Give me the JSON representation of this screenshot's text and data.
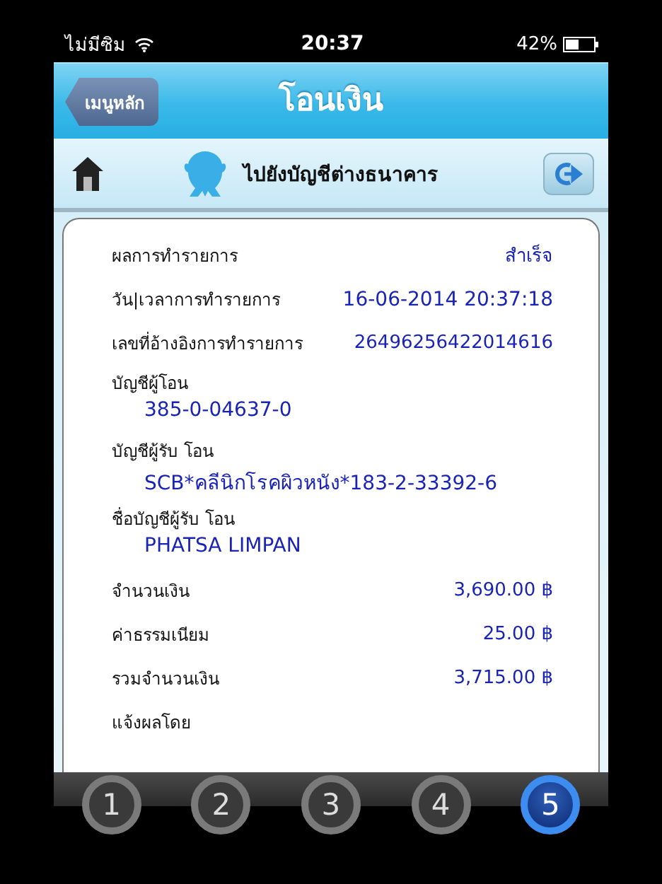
{
  "status_bar": {
    "carrier": "ไม่มีซิม",
    "time": "20:37",
    "battery": "42%"
  },
  "header": {
    "back_button": "เมนูหลัก",
    "title": "โอนเงิน"
  },
  "sub_header": {
    "title": "ไปยังบัญชีต่างธนาคาร"
  },
  "receipt": {
    "rows": [
      {
        "kind": "inline",
        "label": "ผลการทำรายการ",
        "value": "สำเร็จ"
      },
      {
        "kind": "inline",
        "label": "วัน|เวลาการทำรายการ",
        "value": "16-06-2014 20:37:18"
      },
      {
        "kind": "inline",
        "label": "เลขที่อ้างอิงการทำรายการ",
        "value": "26496256422014616"
      },
      {
        "kind": "stacked",
        "label": "บัญชีผู้โอน",
        "value": "385-0-04637-0"
      },
      {
        "kind": "stacked",
        "label": "บัญชีผู้รับ โอน",
        "value": "SCB*คลีนิกโรคผิวหนัง*183-2-33392-6"
      },
      {
        "kind": "stacked",
        "label": "ชื่อบัญชีผู้รับ โอน",
        "value": "PHATSA LIMPAN"
      },
      {
        "kind": "inline",
        "label": "จำนวนเงิน",
        "value": "3,690.00 ฿"
      },
      {
        "kind": "inline",
        "label": "ค่าธรรมเนียม",
        "value": "25.00 ฿"
      },
      {
        "kind": "inline",
        "label": "รวมจำนวนเงิน",
        "value": "3,715.00 ฿"
      },
      {
        "kind": "label",
        "label": "แจ้งผลโดย"
      }
    ]
  },
  "steps": [
    {
      "label": "1",
      "selected": false
    },
    {
      "label": "2",
      "selected": false
    },
    {
      "label": "3",
      "selected": false
    },
    {
      "label": "4",
      "selected": false
    },
    {
      "label": "5",
      "selected": true
    }
  ]
}
